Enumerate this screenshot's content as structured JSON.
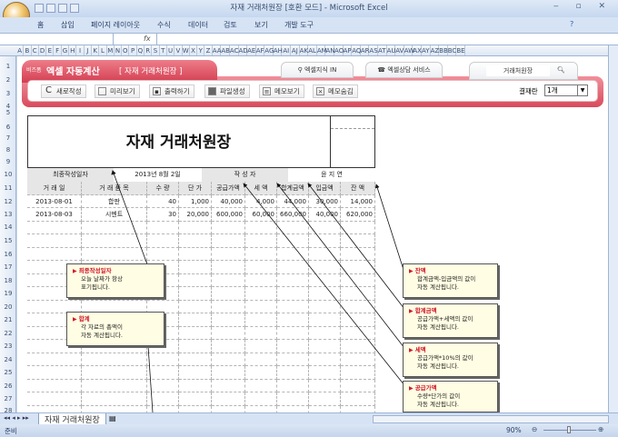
{
  "window": {
    "title": "자재 거래처원장 [호환 모드] - Microsoft Excel"
  },
  "ribbon": {
    "tabs": [
      "홈",
      "삽입",
      "페이지 레이아웃",
      "수식",
      "데이터",
      "검토",
      "보기",
      "개발 도구"
    ]
  },
  "formula_bar": {
    "fx": "fx",
    "value": ""
  },
  "columns": [
    "A",
    "B",
    "C",
    "D",
    "E",
    "F",
    "G",
    "H",
    "I",
    "J",
    "K",
    "L",
    "M",
    "N",
    "O",
    "P",
    "Q",
    "R",
    "S",
    "T",
    "U",
    "V",
    "W",
    "X",
    "Y",
    "Z",
    "AA",
    "AB",
    "AC",
    "AD",
    "AE",
    "AF",
    "AG",
    "AH",
    "AI",
    "AJ",
    "AK",
    "AL",
    "AM",
    "AN",
    "AO",
    "AP",
    "AQ",
    "AR",
    "AS",
    "AT",
    "AU",
    "AV",
    "AW",
    "AX",
    "AY",
    "AZ",
    "BB",
    "BC",
    "BE"
  ],
  "rows": [
    "1",
    "2",
    "3",
    "4",
    "5",
    "6",
    "7",
    "8",
    "9",
    "10",
    "11",
    "12",
    "13",
    "14",
    "15",
    "16",
    "17",
    "18",
    "19",
    "20",
    "21",
    "22",
    "23",
    "24",
    "25",
    "26",
    "27",
    "28"
  ],
  "banner": {
    "brand_small": "비즈폼",
    "brand": "엑셀 자동계산",
    "subtitle": "[ 자재 거래처원장 ]",
    "tab1": "엑셀지식 IN",
    "tab2": "엑셀상담 서비스",
    "search_value": "거래처원장",
    "buttons": [
      "새로작성",
      "미리보기",
      "출력하기",
      "파일생성",
      "메모보기",
      "메모숨김"
    ],
    "approval_label": "결재란",
    "approval_value": "1개"
  },
  "doc": {
    "title": "자재 거래처원장",
    "last_date_label": "최종작성일자",
    "last_date": "2013년 8월 2일",
    "author_label": "작 성 자",
    "author": "윤 지 연",
    "headers": [
      "거 래 일",
      "거 래 품 목",
      "수 량",
      "단 가",
      "공급가액",
      "세 액",
      "합계금액",
      "입금액",
      "잔 액"
    ],
    "rows": [
      [
        "2013-08-01",
        "합판",
        "40",
        "1,000",
        "40,000",
        "4,000",
        "44,000",
        "30,000",
        "14,000"
      ],
      [
        "2013-08-03",
        "시멘트",
        "30",
        "20,000",
        "600,000",
        "60,000",
        "660,000",
        "40,000",
        "620,000"
      ]
    ]
  },
  "callouts": [
    {
      "title": "최종작성일자",
      "lines": [
        "오늘 날짜가 항상",
        "표기됩니다."
      ]
    },
    {
      "title": "합계",
      "lines": [
        "각 자료의 총액이",
        "자동 계산됩니다."
      ]
    },
    {
      "title": "잔액",
      "lines": [
        "합계금액-입금액의 값이",
        "자동 계산됩니다."
      ]
    },
    {
      "title": "합계금액",
      "lines": [
        "공급가액+세액의 값이",
        "자동 계산됩니다."
      ]
    },
    {
      "title": "세액",
      "lines": [
        "공급가액*10%의 값이",
        "자동 계산됩니다."
      ]
    },
    {
      "title": "공급가액",
      "lines": [
        "수량*단가의 값이",
        "자동 계산됩니다."
      ]
    }
  ],
  "sheet_tab": "자재 거래처원장",
  "status": {
    "ready": "준비",
    "zoom": "90%"
  }
}
